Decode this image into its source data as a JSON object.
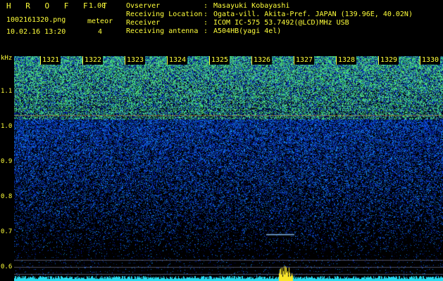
{
  "header": {
    "brand": "H R O F F T",
    "version": "1.00",
    "filename": "1002161320.png",
    "mode": "meteor",
    "datetime": "10.02.16 13:20",
    "count": "4"
  },
  "info": [
    {
      "key": "Ovserver",
      "sep": ":",
      "value": "Masayuki Kobayashi"
    },
    {
      "key": "Receiving Location",
      "sep": ":",
      "value": "Ogata-vill. Akita-Pref. JAPAN (139.96E, 40.02N)"
    },
    {
      "key": "Receiver",
      "sep": ":",
      "value": "ICOM IC-575 53.7492(@LCD)MHz USB"
    },
    {
      "key": "Receiving antenna",
      "sep": ":",
      "value": "A504HB(yagi 4el)"
    }
  ],
  "y_axis": {
    "unit": "kHz",
    "ticks": [
      "1.1",
      "1.0",
      "0.9",
      "0.8",
      "0.7",
      "0.6"
    ]
  },
  "x_axis": {
    "ticks": [
      "1321",
      "1322",
      "1323",
      "1324",
      "1325",
      "1326",
      "1327",
      "1328",
      "1329",
      "1330"
    ]
  },
  "colors": {
    "label": "#ffff3a",
    "background": "#000000",
    "noise_high": "#2fd08a",
    "noise_mid": "#1a46d6",
    "noise_low": "#061a80"
  }
}
